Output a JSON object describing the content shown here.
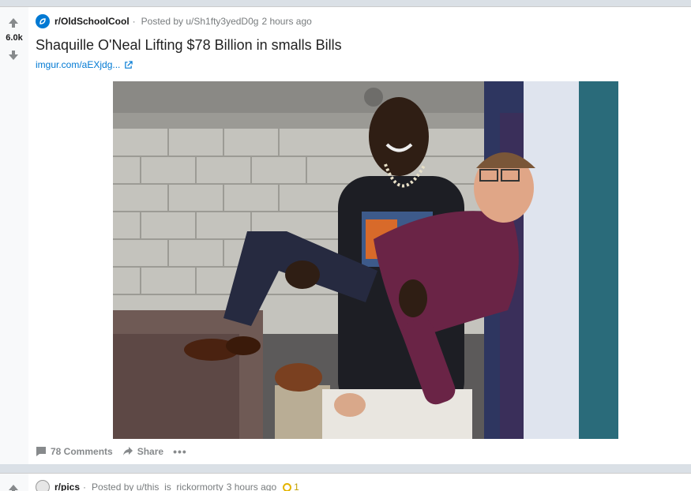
{
  "post": {
    "score": "6.0k",
    "subreddit": "r/OldSchoolCool",
    "posted_by": "Posted by u/Sh1fty3yedD0g",
    "time": "2 hours ago",
    "title": "Shaquille O'Neal Lifting $78 Billion in smalls Bills",
    "link": "imgur.com/aEXjdg...",
    "comments_label": "78 Comments",
    "share_label": "Share",
    "more_label": "•••"
  },
  "next_post": {
    "subreddit": "r/pics",
    "posted_by": "Posted by u/this_is_rickormorty",
    "time": "3 hours ago",
    "awards": "1"
  },
  "colors": {
    "background": "#dae0e6",
    "link_blue": "#0079d3",
    "text": "#1a1a1b",
    "meta_gray": "#787c7e"
  },
  "icons": [
    "upvote-arrow-icon",
    "downvote-arrow-icon",
    "subreddit-icon",
    "external-link-icon",
    "comment-icon",
    "share-icon",
    "award-icon"
  ]
}
